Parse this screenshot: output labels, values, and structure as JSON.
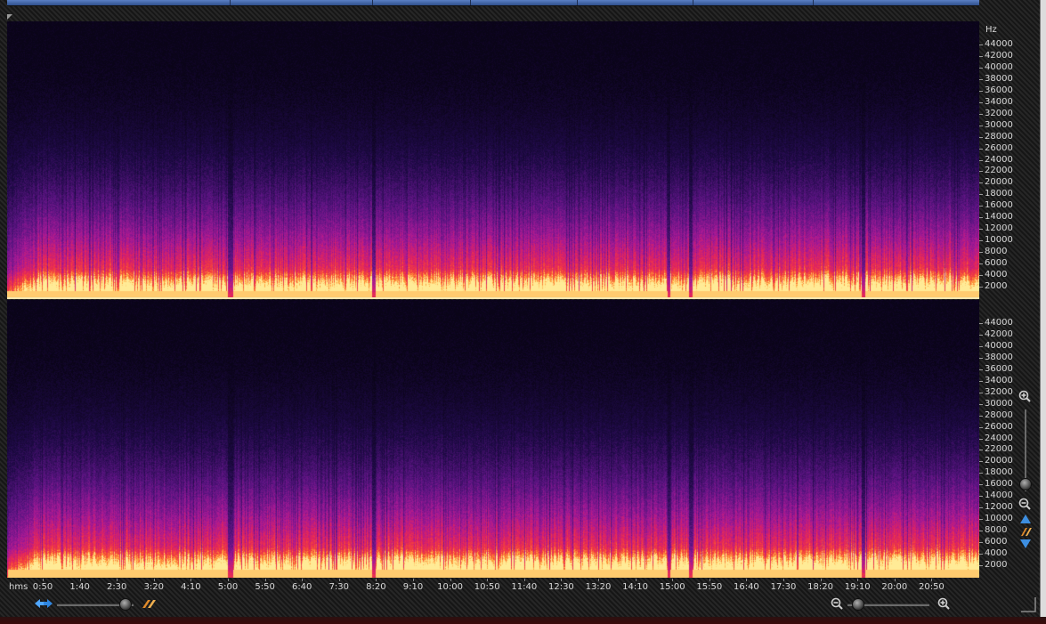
{
  "app": {
    "view": "spectral frequency display"
  },
  "frequency_axis": {
    "unit_label": "Hz",
    "labels": [
      "44000",
      "42000",
      "40000",
      "38000",
      "36000",
      "34000",
      "32000",
      "30000",
      "28000",
      "26000",
      "24000",
      "22000",
      "20000",
      "18000",
      "16000",
      "14000",
      "12000",
      "10000",
      "8000",
      "6000",
      "4000",
      "2000"
    ]
  },
  "time_axis": {
    "unit_label": "hms",
    "labels": [
      "0:50",
      "1:40",
      "2:30",
      "3:20",
      "4:10",
      "5:00",
      "5:50",
      "6:40",
      "7:30",
      "8:20",
      "9:10",
      "10:00",
      "10:50",
      "11:40",
      "12:30",
      "13:20",
      "14:10",
      "15:00",
      "15:50",
      "16:40",
      "17:30",
      "18:20",
      "19:10",
      "20:00",
      "20:50"
    ]
  },
  "channels": [
    {
      "name": "top-channel"
    },
    {
      "name": "bottom-channel"
    }
  ],
  "colors": {
    "background": "#1b1b1b",
    "low_energy": "#140a3a",
    "mid_energy": "#8a1aa0",
    "high_energy": "#f02a4a",
    "peak_energy": "#ffd060"
  },
  "controls": {
    "horizontal_zoom_level": 0.22,
    "vertical_zoom_level": 0.9,
    "bottom_right_zoom_level": 0.05
  },
  "icons": {
    "scroll_left": "scroll-both-icon",
    "spectral_toggle": "spectral-brush-icon",
    "zoom_out_h": "zoom-out-icon",
    "zoom_in_h": "zoom-in-icon",
    "zoom_in_v": "zoom-in-icon",
    "zoom_out_v": "zoom-out-icon"
  }
}
